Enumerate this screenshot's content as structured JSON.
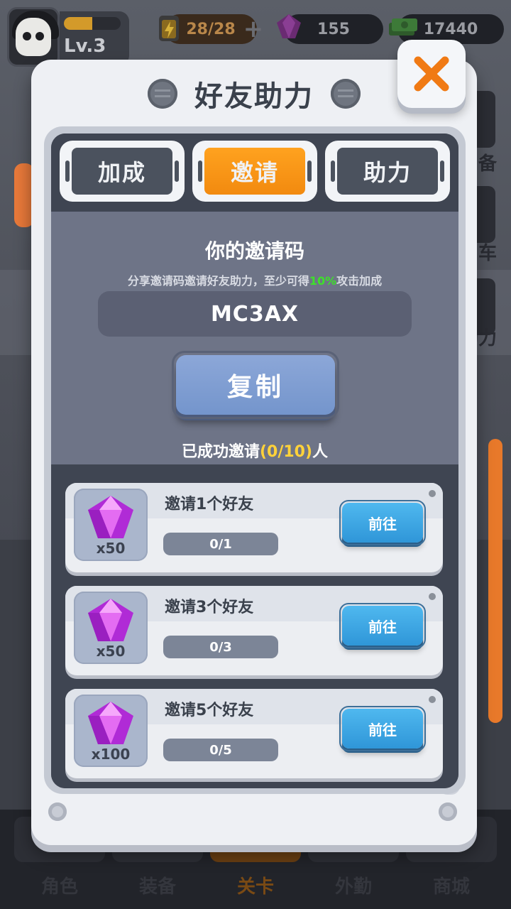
{
  "hud": {
    "level": "Lv.3",
    "level_progress": 0.5,
    "energy": "28/28",
    "plus": "+",
    "gems": "155",
    "cash": "17440"
  },
  "bottom_nav": [
    "角色",
    "装备",
    "关卡",
    "外勤",
    "商城"
  ],
  "side_labels": [
    "备",
    "车",
    "助力"
  ],
  "modal": {
    "title": "好友助力",
    "close_icon": "close-x-icon",
    "tabs": [
      {
        "label": "加成",
        "active": false
      },
      {
        "label": "邀请",
        "active": true
      },
      {
        "label": "助力",
        "active": false
      }
    ],
    "invite": {
      "title": "你的邀请码",
      "desc_before": "分享邀请码邀请好友助力，至少可得",
      "desc_highlight": "10%",
      "desc_after": "攻击加成",
      "code": "MC3AX",
      "copy_label": "复制",
      "invited_before": "已成功邀请",
      "invited_count": "(0/10)",
      "invited_after": "人"
    },
    "rewards": [
      {
        "task": "邀请1个好友",
        "reward_qty": "x50",
        "progress": "0/1",
        "button": "前往"
      },
      {
        "task": "邀请3个好友",
        "reward_qty": "x50",
        "progress": "0/3",
        "button": "前往"
      },
      {
        "task": "邀请5个好友",
        "reward_qty": "x100",
        "progress": "0/5",
        "button": "前往"
      }
    ]
  },
  "colors": {
    "accent_orange": "#f28a0f",
    "highlight_green": "#3ee02a",
    "highlight_yellow": "#ffd23a",
    "go_button_blue": "#2f96d8"
  }
}
